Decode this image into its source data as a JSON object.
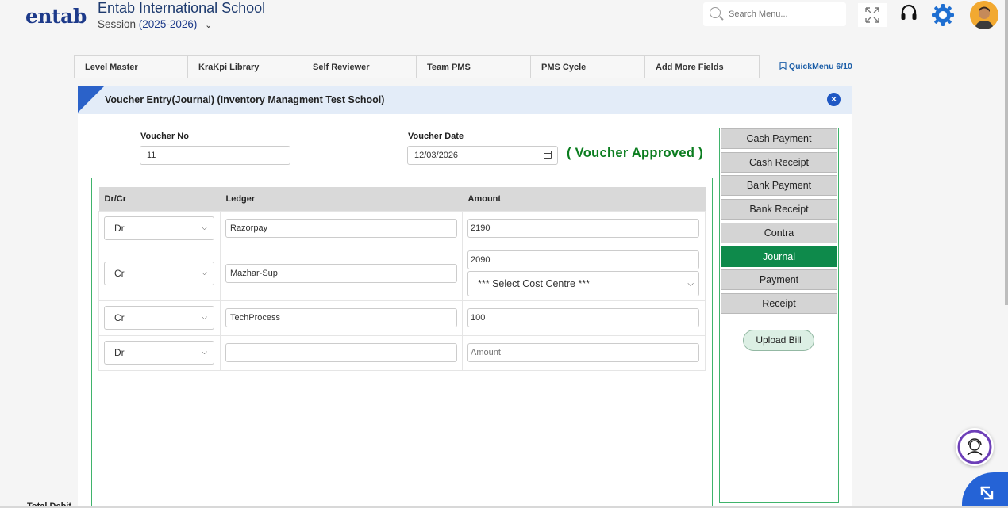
{
  "header": {
    "logo_text": "entab",
    "school_name": "Entab International School",
    "session_label": "Session",
    "session_value": "(2025-2026)",
    "search_placeholder": "Search Menu..."
  },
  "topnav": {
    "tabs": [
      "Level Master",
      "KraKpi Library",
      "Self Reviewer",
      "Team PMS",
      "PMS Cycle",
      "Add More Fields"
    ],
    "quickmenu": "QuickMenu 6/10"
  },
  "panel": {
    "title": "Voucher Entry(Journal) (Inventory Managment Test School)",
    "voucher_no_label": "Voucher No",
    "voucher_no": "11",
    "voucher_date_label": "Voucher Date",
    "voucher_date": "12/03/2026",
    "status": "( Voucher Approved )",
    "columns": {
      "drcr": "Dr/Cr",
      "ledger": "Ledger",
      "amount": "Amount"
    },
    "rows": [
      {
        "drcr": "Dr",
        "ledger": "Razorpay",
        "amount": "2190"
      },
      {
        "drcr": "Cr",
        "ledger": "Mazhar-Sup",
        "amount": "2090",
        "cost_centre": "*** Select Cost Centre ***"
      },
      {
        "drcr": "Cr",
        "ledger": "TechProcess",
        "amount": "100"
      },
      {
        "drcr": "Dr",
        "ledger": "",
        "amount": "",
        "amount_placeholder": "Amount"
      }
    ],
    "total_debit_label": "Total Debit"
  },
  "side": {
    "buttons": [
      "Cash Payment",
      "Cash Receipt",
      "Bank Payment",
      "Bank Receipt",
      "Contra",
      "Journal",
      "Payment",
      "Receipt"
    ],
    "active": "Journal",
    "upload": "Upload Bill"
  },
  "colors": {
    "approved_green": "#0b7d1f",
    "active_green": "#0e8a4b",
    "brand_blue": "#1d3a8a"
  }
}
